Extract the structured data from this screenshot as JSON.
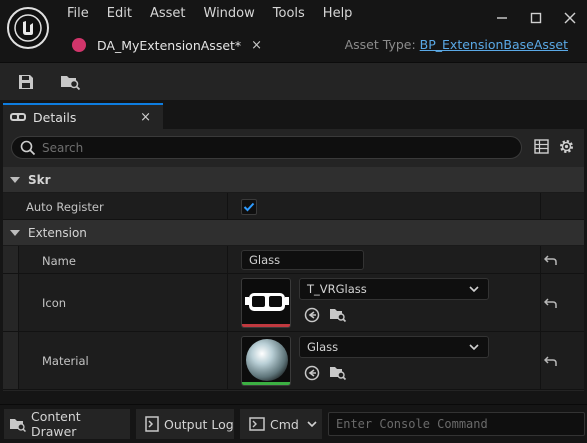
{
  "app": {
    "menu": [
      "File",
      "Edit",
      "Asset",
      "Window",
      "Tools",
      "Help"
    ],
    "window_controls": [
      "minimize-icon",
      "maximize-icon",
      "close-icon"
    ]
  },
  "document_tab": {
    "title": "DA_MyExtensionAsset*",
    "close": "×",
    "accent_color": "#d1356b"
  },
  "asset_type": {
    "label": "Asset Type: ",
    "value": "BP_ExtensionBaseAsset"
  },
  "toolbar": {
    "buttons": [
      "save-icon",
      "browse-to-asset-icon"
    ]
  },
  "details": {
    "tab_label": "Details",
    "tab_close": "×",
    "search_placeholder": "Search",
    "categories": {
      "skr": "Skr",
      "extension": "Extension"
    },
    "rows": {
      "auto_register": {
        "label": "Auto Register",
        "checked": true
      },
      "name": {
        "label": "Name",
        "value": "Glass"
      },
      "icon": {
        "label": "Icon",
        "value": "T_VRGlass",
        "bar_color": "#c0393f"
      },
      "material": {
        "label": "Material",
        "value": "Glass",
        "bar_color": "#3cb043"
      }
    }
  },
  "bottom": {
    "content_drawer": "Content Drawer",
    "output_log": "Output Log",
    "cmd": "Cmd",
    "console_placeholder": "Enter Console Command"
  },
  "colors": {
    "accent_blue": "#0e7de0",
    "link": "#5aa9e6"
  }
}
